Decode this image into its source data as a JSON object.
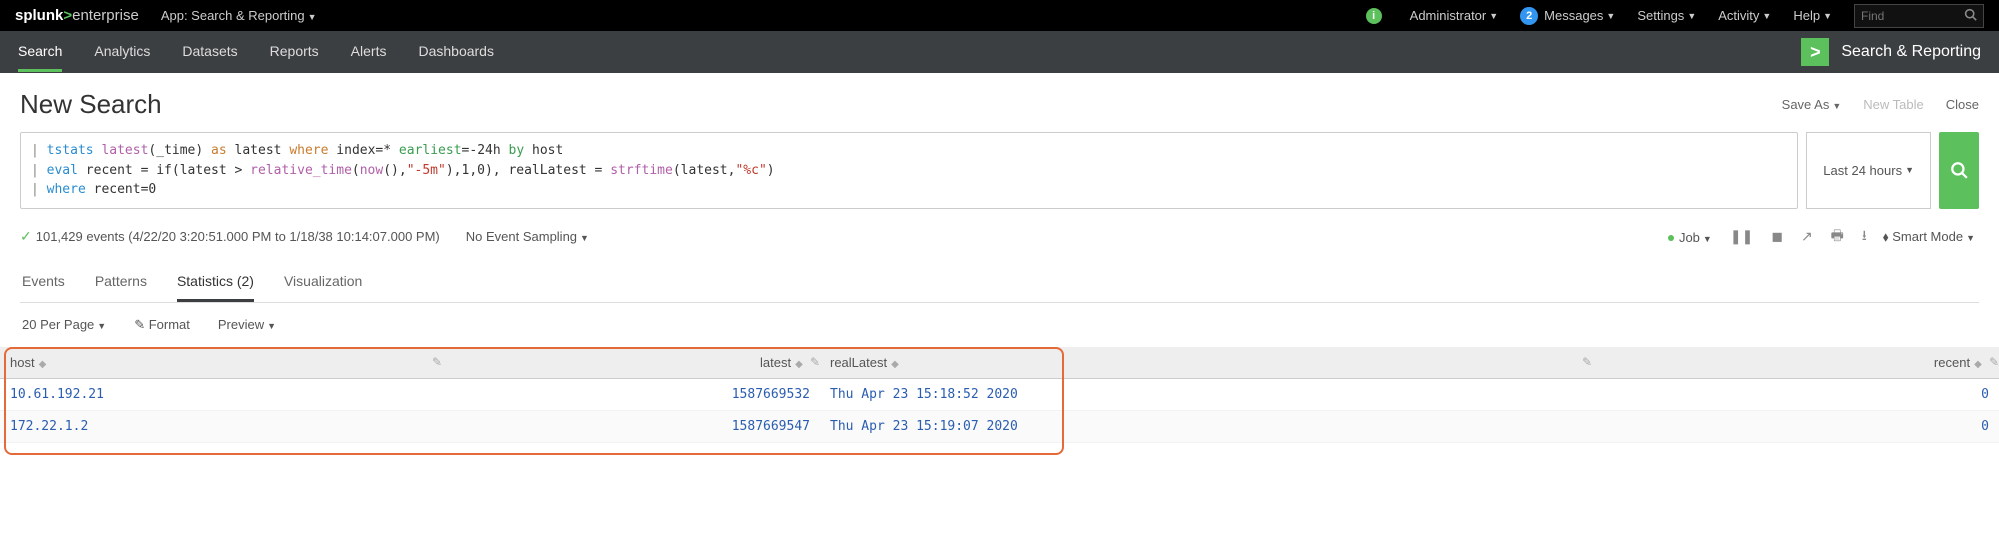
{
  "topbar": {
    "logo_pre": "splunk",
    "logo_gt": ">",
    "logo_post": "enterprise",
    "app_label": "App: Search & Reporting",
    "admin": "Administrator",
    "messages_count": "2",
    "messages": "Messages",
    "settings": "Settings",
    "activity": "Activity",
    "help": "Help",
    "find_placeholder": "Find"
  },
  "nav": {
    "items": [
      "Search",
      "Analytics",
      "Datasets",
      "Reports",
      "Alerts",
      "Dashboards"
    ],
    "right_label": "Search & Reporting"
  },
  "page": {
    "title": "New Search",
    "save_as": "Save As",
    "new_table": "New Table",
    "close": "Close"
  },
  "search": {
    "time_label": "Last 24 hours",
    "spl_display": "| tstats latest(_time) as latest where index=* earliest=-24h by host\n| eval recent = if(latest > relative_time(now(),\"-5m\"),1,0), realLatest = strftime(latest,\"%c\")\n| where recent=0"
  },
  "status": {
    "events_line": "101,429 events (4/22/20 3:20:51.000 PM to 1/18/38 10:14:07.000 PM)",
    "sampling": "No Event Sampling",
    "job": "Job",
    "smart_mode": "Smart Mode"
  },
  "tabs": {
    "events": "Events",
    "patterns": "Patterns",
    "statistics": "Statistics (2)",
    "visualization": "Visualization"
  },
  "controls": {
    "per_page": "20 Per Page",
    "format": "Format",
    "preview": "Preview"
  },
  "table": {
    "cols": {
      "host": "host",
      "latest": "latest",
      "realLatest": "realLatest",
      "recent": "recent"
    },
    "rows": [
      {
        "host": "10.61.192.21",
        "latest": "1587669532",
        "realLatest": "Thu Apr 23 15:18:52 2020",
        "recent": "0"
      },
      {
        "host": "172.22.1.2",
        "latest": "1587669547",
        "realLatest": "Thu Apr 23 15:19:07 2020",
        "recent": "0"
      }
    ]
  },
  "chart_data": {
    "type": "table",
    "columns": [
      "host",
      "latest",
      "realLatest",
      "recent"
    ],
    "rows": [
      [
        "10.61.192.21",
        1587669532,
        "Thu Apr 23 15:18:52 2020",
        0
      ],
      [
        "172.22.1.2",
        1587669547,
        "Thu Apr 23 15:19:07 2020",
        0
      ]
    ]
  }
}
